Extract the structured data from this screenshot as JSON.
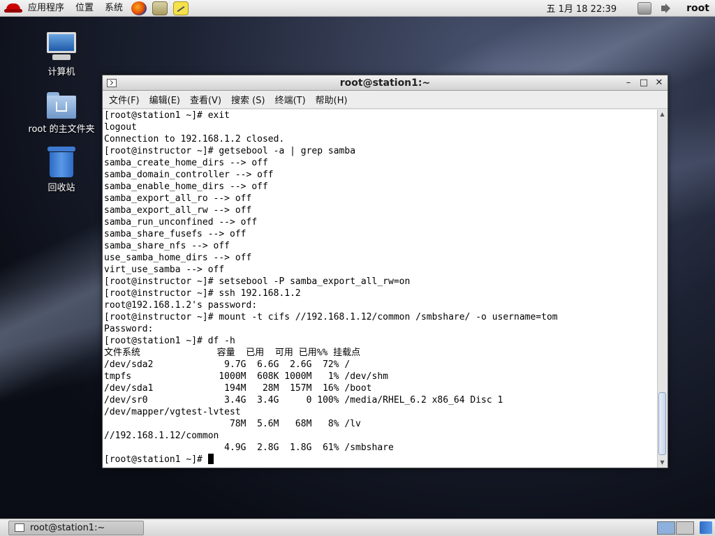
{
  "top_panel": {
    "menus": [
      "应用程序",
      "位置",
      "系统"
    ],
    "clock": "五 1月 18 22:39",
    "user": "root"
  },
  "desktop_icons": [
    {
      "label": "计算机",
      "icon": "computer-icon"
    },
    {
      "label": "root 的主文件夹",
      "icon": "home-folder-icon"
    },
    {
      "label": "回收站",
      "icon": "trash-icon"
    }
  ],
  "terminal": {
    "title": "root@station1:~",
    "menus": [
      "文件(F)",
      "编辑(E)",
      "查看(V)",
      "搜索 (S)",
      "终端(T)",
      "帮助(H)"
    ],
    "lines": [
      "[root@station1 ~]# exit",
      "logout",
      "Connection to 192.168.1.2 closed.",
      "[root@instructor ~]# getsebool -a | grep samba",
      "samba_create_home_dirs --> off",
      "samba_domain_controller --> off",
      "samba_enable_home_dirs --> off",
      "samba_export_all_ro --> off",
      "samba_export_all_rw --> off",
      "samba_run_unconfined --> off",
      "samba_share_fusefs --> off",
      "samba_share_nfs --> off",
      "use_samba_home_dirs --> off",
      "virt_use_samba --> off",
      "[root@instructor ~]# setsebool -P samba_export_all_rw=on",
      "[root@instructor ~]# ssh 192.168.1.2",
      "root@192.168.1.2's password:",
      "[root@instructor ~]# mount -t cifs //192.168.1.12/common /smbshare/ -o username=tom",
      "Password:",
      "[root@station1 ~]# df -h",
      "文件系统              容量  已用  可用 已用%% 挂载点",
      "/dev/sda2             9.7G  6.6G  2.6G  72% /",
      "tmpfs                1000M  608K 1000M   1% /dev/shm",
      "/dev/sda1             194M   28M  157M  16% /boot",
      "/dev/sr0              3.4G  3.4G     0 100% /media/RHEL_6.2 x86_64 Disc 1",
      "/dev/mapper/vgtest-lvtest",
      "                       78M  5.6M   68M   8% /lv",
      "//192.168.1.12/common",
      "                      4.9G  2.8G  1.8G  61% /smbshare"
    ],
    "prompt": "[root@station1 ~]# "
  },
  "bottom_panel": {
    "task": "root@station1:~"
  }
}
